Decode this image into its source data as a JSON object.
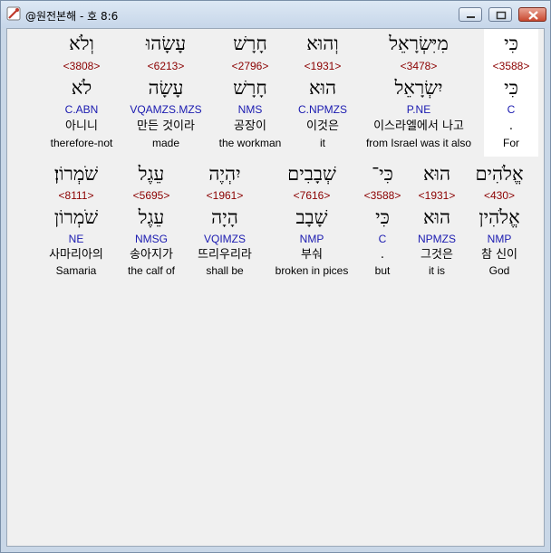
{
  "window": {
    "title": "@원전본해 - 호 8:6",
    "accent": "#c9d7e7"
  },
  "rows": [
    {
      "words": [
        {
          "hebrew": "כִּי",
          "strong": "<3588>",
          "root": "כִּי",
          "morph": "C",
          "korean": ".",
          "english": "For",
          "selected": true
        },
        {
          "hebrew": "מִיִּשְׂרָאֵל",
          "strong": "<3478>",
          "root": "יִשְׂרָאֵל",
          "morph": "P.NE",
          "korean": "이스라엘에서 나고",
          "english": "from Israel was it also",
          "selected": false
        },
        {
          "hebrew": "וְהוּא",
          "strong": "<1931>",
          "root": "הוּא",
          "morph": "C.NPMZS",
          "korean": "이것은",
          "english": "it",
          "selected": false
        },
        {
          "hebrew": "חָרָשׁ",
          "strong": "<2796>",
          "root": "חָרָשׁ",
          "morph": "NMS",
          "korean": "공장이",
          "english": "the workman",
          "selected": false
        },
        {
          "hebrew": "עָשָׂהוּ",
          "strong": "<6213>",
          "root": "עָשָׂה",
          "morph": "VQAMZS.MZS",
          "korean": "만든 것이라",
          "english": "made",
          "selected": false
        },
        {
          "hebrew": "וְלֹא",
          "strong": "<3808>",
          "root": "לֹא",
          "morph": "C.ABN",
          "korean": "아니니",
          "english": "therefore-not",
          "selected": false
        }
      ]
    },
    {
      "words": [
        {
          "hebrew": "אֱלֹהִים",
          "strong": "<430>",
          "root": "אֱלֹהִין",
          "morph": "NMP",
          "korean": "참 신이",
          "english": "God",
          "selected": false
        },
        {
          "hebrew": "הוּא",
          "strong": "<1931>",
          "root": "הוּא",
          "morph": "NPMZS",
          "korean": "그것은",
          "english": "it is",
          "selected": false
        },
        {
          "hebrew": "כִּי־",
          "strong": "<3588>",
          "root": "כִּי",
          "morph": "C",
          "korean": ".",
          "english": "but",
          "selected": false
        },
        {
          "hebrew": "שְׁבָבִים",
          "strong": "<7616>",
          "root": "שָׁבָב",
          "morph": "NMP",
          "korean": "부숴",
          "english": "broken in pices",
          "selected": false
        },
        {
          "hebrew": "יִהְיֶה",
          "strong": "<1961>",
          "root": "הָיָה",
          "morph": "VQIMZS",
          "korean": "뜨리우리라",
          "english": "shall be",
          "selected": false
        },
        {
          "hebrew": "עֵגֶל",
          "strong": "<5695>",
          "root": "עֵגֶל",
          "morph": "NMSG",
          "korean": "송아지가",
          "english": "the calf of",
          "selected": false
        },
        {
          "hebrew": "שֹׁמְרוֹן׃",
          "strong": "<8111>",
          "root": "שֹׁמְרוֹן",
          "morph": "NE",
          "korean": "사마리아의",
          "english": "Samaria",
          "selected": false
        }
      ]
    }
  ]
}
